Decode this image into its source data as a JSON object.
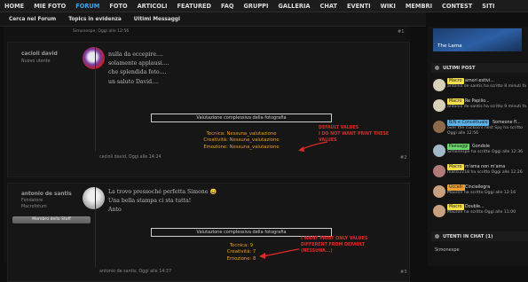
{
  "nav": {
    "items": [
      "HOME",
      "MIE FOTO",
      "FORUM",
      "FOTO",
      "ARTICOLI",
      "FEATURED",
      "FAQ",
      "GRUPPI",
      "GALLERIA",
      "CHAT",
      "EVENTI",
      "WIKI",
      "MEMBRI",
      "CONTEST",
      "SITI"
    ],
    "active": "FORUM"
  },
  "subnav": {
    "items": [
      "Cerca nel Forum",
      "Topics in evidenza",
      "Ultimi Messaggi"
    ]
  },
  "top_line": {
    "text": "Simonespe, Oggi alle 12:56",
    "num": "#1"
  },
  "posts": [
    {
      "username": "cacioli david",
      "role": "Nuovo utente",
      "body": [
        "nulla da eccepire....",
        "solamente applausi....",
        "che splendida foto....",
        "un saluto David...."
      ],
      "rating_title": "Valutazione complessiva della fotografia",
      "ratings": [
        "Tecnica: Nessuna_valutazione",
        "Creatività: Nessuna_valutazione",
        "Emozione: Nessuna_valutazione"
      ],
      "footer": "cacioli david, Oggi alle 14:24",
      "num": "#2",
      "note": "DEFAULT VALUES\nI DO NOT WANT PRINT THESE\nVALUES"
    },
    {
      "username": "antonio de santis",
      "role": "Fondatore",
      "role2": "Macrofotum",
      "staff": "Membro dello Staff",
      "body": [
        "La trovo pressoché perfetta Simone 😀",
        "Una bella stampa ci sta tutta!",
        "Anto"
      ],
      "rating_title": "Valutazione complessiva della fotografia",
      "ratings": [
        "Tecnica: 9",
        "Creatività: 7",
        "Emozione: 8"
      ],
      "footer": "antonio de santis, Oggi alle 14:37",
      "num": "#3",
      "note": "I WANT PRINT ONLY VALUES\nDIFFERENT FROM DEFAULT\n(NESSUNA...)"
    }
  ],
  "sidebar": {
    "banner_text": "The Lama",
    "latest_title": "ULTIMI POST",
    "latest": [
      {
        "tag": "Macro",
        "tag_color": "#f6e04a",
        "title": "amori estivi...",
        "by": "antonio de santis ha scritto 8 minuti fa",
        "avatar_color": "#d8d0b8"
      },
      {
        "tag": "Macro",
        "tag_color": "#f6e04a",
        "title": "Re Papilio...",
        "by": "antonio de santis ha scritto 9 minuti fa",
        "avatar_color": "#d8d0b8"
      },
      {
        "tag": "B/N e Concettuale",
        "tag_color": "#5ab0e8",
        "title": "Someone fl...",
        "by": "over the cuckoo's nest Spy ha scritto Oggi alle 12:56",
        "avatar_color": "#8a6a4a"
      },
      {
        "tag": "Paesaggi",
        "tag_color": "#6ad86a",
        "title": "Gondole",
        "by": "Simonespe ha scritto Oggi alle 12:36",
        "avatar_color": "#a0b8c8"
      },
      {
        "tag": "Macro",
        "tag_color": "#f6e04a",
        "title": "m'ama non m'ama",
        "by": "massi2218 ha scritto Oggi alle 12:26",
        "avatar_color": "#b07a7a"
      },
      {
        "tag": "Uccelli",
        "tag_color": "#f0a030",
        "title": "Cinciallegra",
        "by": "MauroV ha scritto Oggi alle 12:16",
        "avatar_color": "#c8a080"
      },
      {
        "tag": "Macro",
        "tag_color": "#f6e04a",
        "title": "Double...",
        "by": "MauroV ha scritto Oggi alle 11:00",
        "avatar_color": "#c8a080"
      }
    ],
    "chat_title": "UTENTI IN CHAT (1)",
    "chat_users": [
      "Simonespe"
    ]
  }
}
